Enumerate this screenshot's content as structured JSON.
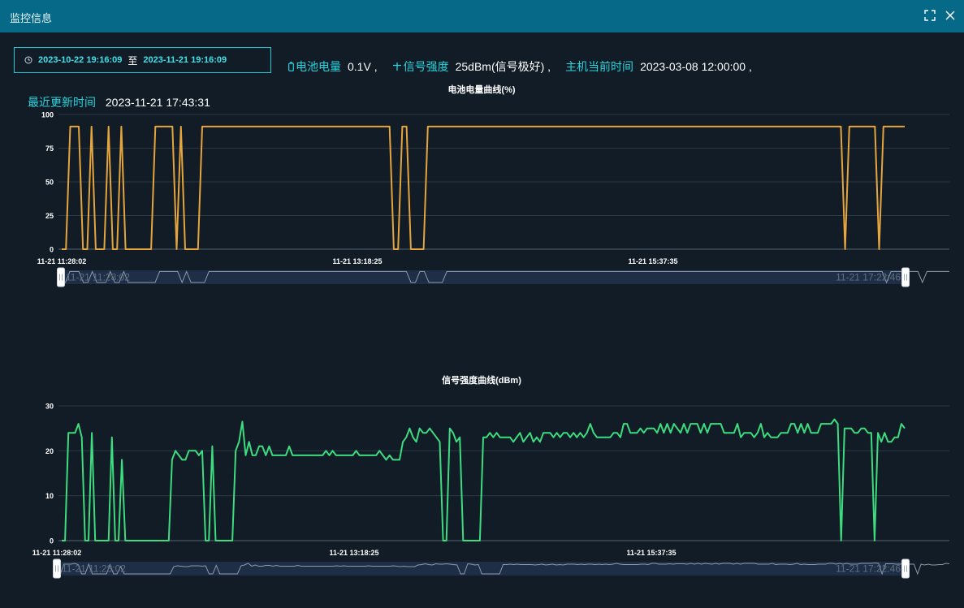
{
  "window": {
    "title": "监控信息",
    "fullscreen_icon": "fullscreen-icon",
    "close_icon": "close-icon"
  },
  "filter": {
    "start": "2023-10-22 19:16:09",
    "separator": "至",
    "end": "2023-11-21 19:16:09",
    "icon": "clock-icon"
  },
  "stats": {
    "battery_label": "电池电量",
    "battery_value": "0.1V ,",
    "signal_label": "信号强度",
    "signal_value": "25dBm(信号极好) ,",
    "host_time_label": "主机当前时间",
    "host_time_value": "2023-03-08 12:00:00 ,",
    "update_label": "最近更新时间",
    "update_value": "2023-11-21 17:43:31"
  },
  "colors": {
    "titlebar": "#066987",
    "background": "#111c27",
    "accent": "#28d4dd",
    "battery_line": "#e6a53c",
    "signal_line": "#3ddc7e"
  },
  "chart_data": [
    {
      "type": "line",
      "title": "电池电量曲线(%)",
      "ylim": [
        0,
        100
      ],
      "yticks": [
        "0",
        "25",
        "50",
        "75",
        "100"
      ],
      "xtick_labels": [
        "11-21 11:28:02",
        "11-21 13:18:25",
        "11-21 15:37:35"
      ],
      "slider_labels": [
        "11-21 11:28:02",
        "11-21 17:22:46"
      ],
      "grid": true,
      "series": [
        {
          "values": [
            0,
            0,
            91,
            91,
            91,
            0,
            0,
            91,
            0,
            0,
            0,
            91,
            0,
            0,
            91,
            0,
            0,
            0,
            0,
            0,
            0,
            0,
            91,
            91,
            91,
            91,
            91,
            0,
            91,
            0,
            0,
            0,
            0,
            91,
            91,
            91,
            91,
            91,
            91,
            91,
            91,
            91,
            91,
            91,
            91,
            91,
            91,
            91,
            91,
            91,
            91,
            91,
            91,
            91,
            91,
            91,
            91,
            91,
            91,
            91,
            91,
            91,
            91,
            91,
            91,
            91,
            91,
            91,
            91,
            91,
            91,
            91,
            91,
            91,
            91,
            91,
            91,
            91,
            0,
            0,
            91,
            91,
            0,
            0,
            0,
            0,
            91,
            91,
            91,
            91,
            91,
            91,
            91,
            91,
            91,
            91,
            91,
            91,
            91,
            91,
            91,
            91,
            91,
            91,
            91,
            91,
            91,
            91,
            91,
            91,
            91,
            91,
            91,
            91,
            91,
            91,
            91,
            91,
            91,
            91,
            91,
            91,
            91,
            91,
            91,
            91,
            91,
            91,
            91,
            91,
            91,
            91,
            91,
            91,
            91,
            91,
            91,
            91,
            91,
            91,
            91,
            91,
            91,
            91,
            91,
            91,
            91,
            91,
            91,
            91,
            91,
            91,
            91,
            91,
            91,
            91,
            91,
            91,
            91,
            91,
            91,
            91,
            91,
            91,
            91,
            91,
            91,
            91,
            91,
            91,
            91,
            91,
            91,
            91,
            91,
            91,
            91,
            91,
            91,
            91,
            91,
            91,
            91,
            91,
            0,
            91,
            91,
            91,
            91,
            91,
            91,
            91,
            0,
            91,
            91,
            91,
            91,
            91,
            91
          ]
        }
      ]
    },
    {
      "type": "line",
      "title": "信号强度曲线(dBm)",
      "ylim": [
        0,
        30
      ],
      "yticks": [
        "0",
        "10",
        "20",
        "30"
      ],
      "xtick_labels": [
        "11-21 11:28:02",
        "11-21 13:18:25",
        "11-21 15:37:35"
      ],
      "slider_labels": [
        "11-21 11:28:02",
        "11-21 17:22:46"
      ],
      "grid": true,
      "series": [
        {
          "values": [
            0,
            0,
            24,
            24,
            24,
            26,
            23,
            0,
            0,
            24,
            0,
            0,
            0,
            0,
            0,
            23,
            0,
            0,
            18,
            0,
            0,
            0,
            0,
            0,
            0,
            0,
            0,
            0,
            0,
            0,
            0,
            0,
            0,
            18,
            20,
            19,
            18,
            18,
            20,
            20,
            20,
            19,
            20,
            0,
            0,
            21,
            0,
            0,
            0,
            0,
            0,
            0,
            20,
            22,
            26.5,
            19,
            22,
            19,
            19,
            21,
            21,
            19,
            21,
            19,
            19,
            19,
            19,
            19,
            21,
            19,
            19,
            19,
            19,
            19,
            19,
            19,
            19,
            19,
            19,
            20,
            19,
            20,
            19,
            19,
            19,
            19,
            19,
            19,
            20,
            19,
            19,
            19,
            19,
            19,
            19,
            20,
            19,
            18,
            19,
            18,
            18,
            18,
            22,
            23,
            25,
            23,
            22,
            25,
            24,
            24,
            25,
            24,
            23,
            22,
            0,
            0,
            25,
            24,
            22,
            23,
            0,
            0,
            0,
            0,
            0,
            0,
            23,
            23,
            24,
            23,
            24,
            23,
            23,
            23,
            23,
            22,
            23,
            24,
            22,
            23,
            24,
            22,
            23,
            22,
            24,
            24,
            24,
            23,
            24,
            23,
            24,
            24,
            23,
            24,
            23,
            24,
            23,
            24,
            26,
            24,
            23,
            23,
            23,
            23,
            23,
            24,
            24,
            23,
            26,
            26,
            24,
            24,
            24,
            25,
            24,
            25,
            25,
            25,
            24,
            26,
            24,
            26,
            24,
            26,
            25,
            24,
            26,
            24,
            26,
            26,
            26,
            24,
            26,
            24,
            26,
            26,
            26,
            26,
            24,
            24,
            24,
            24,
            26,
            23,
            24,
            24,
            24,
            23,
            24,
            26,
            23,
            24,
            23,
            23,
            23,
            24,
            24,
            24,
            26,
            26,
            24,
            26,
            24,
            26,
            24,
            24,
            24,
            26,
            26,
            26,
            26,
            27,
            26,
            0,
            25,
            25,
            25,
            24,
            24,
            25,
            25,
            24,
            24,
            0,
            24,
            22,
            24,
            22,
            22,
            23,
            23,
            26,
            25
          ]
        }
      ]
    }
  ]
}
